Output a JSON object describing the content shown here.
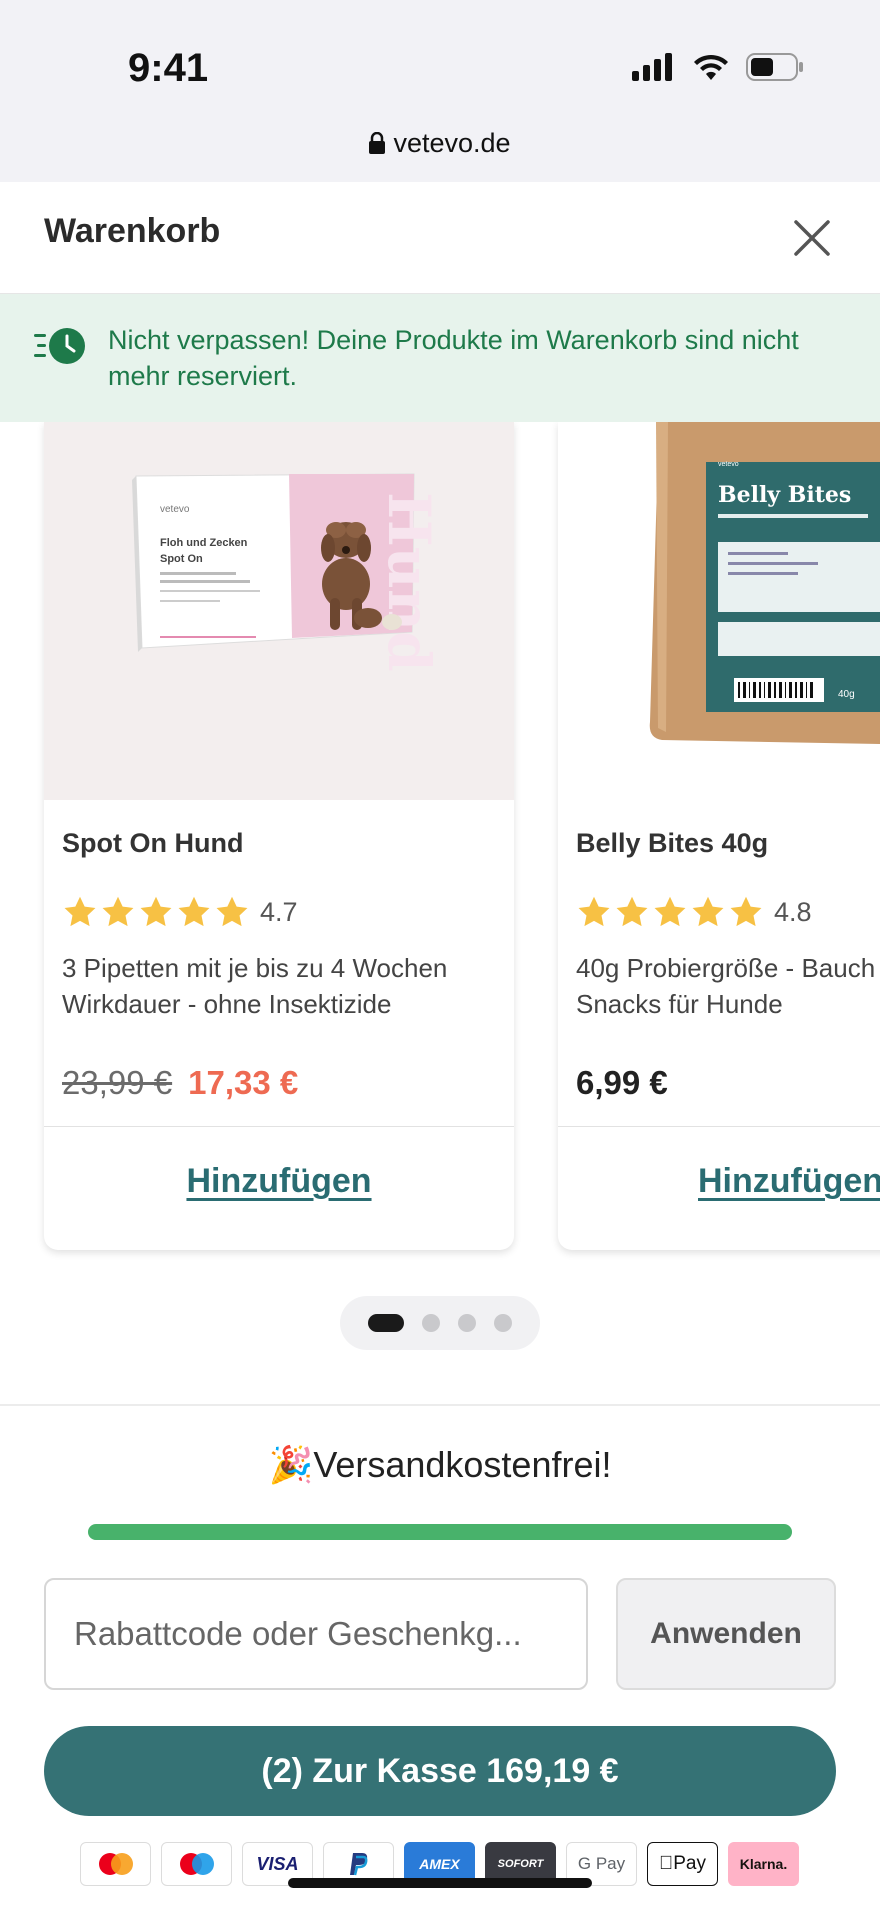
{
  "status_bar": {
    "time": "9:41",
    "url": "vetevo.de"
  },
  "header": {
    "title": "Warenkorb"
  },
  "notice": {
    "text": "Nicht verpassen! Deine Produkte im Warenkorb sind nicht mehr reserviert."
  },
  "products": [
    {
      "title": "Spot On Hund",
      "rating": "4.7",
      "stars": 5,
      "description_line1": "3 Pipetten mit je bis zu 4 Wochen",
      "description_line2": "Wirkdauer - ohne Insektizide",
      "old_price": "23,99 €",
      "price": "17,33 €",
      "add_label": "Hinzufügen",
      "package": {
        "brand": "vetevo",
        "name_line1": "Floh und Zecken",
        "name_line2": "Spot On",
        "side_text": "Hund"
      }
    },
    {
      "title": "Belly Bites 40g",
      "rating": "4.8",
      "stars": 5,
      "description_line1": "40g Probiergröße - Bauch",
      "description_line2": "Snacks für Hunde",
      "price": "6,99 €",
      "add_label": "Hinzufügen",
      "package": {
        "brand": "vetevo",
        "name": "Belly Bites",
        "weight": "40g"
      }
    }
  ],
  "carousel": {
    "pages": 4,
    "active_page": 1
  },
  "shipping": {
    "emoji": "🎉",
    "label": "Versandkostenfrei!",
    "progress": 1.0
  },
  "coupon": {
    "placeholder": "Rabattcode oder Geschenkg...",
    "apply_label": "Anwenden"
  },
  "checkout": {
    "label": "(2) Zur Kasse 169,19 €"
  },
  "payment_methods": [
    "Mastercard",
    "Maestro",
    "VISA",
    "PayPal",
    "AMEX",
    "SOFORT",
    "G Pay",
    "Pay",
    "Klarna."
  ],
  "colors": {
    "accent": "#357275",
    "link": "#2a6c72",
    "sale": "#ee6a52",
    "success": "#48b26b",
    "notice_bg": "#e7f3ec",
    "star": "#f7c144"
  }
}
